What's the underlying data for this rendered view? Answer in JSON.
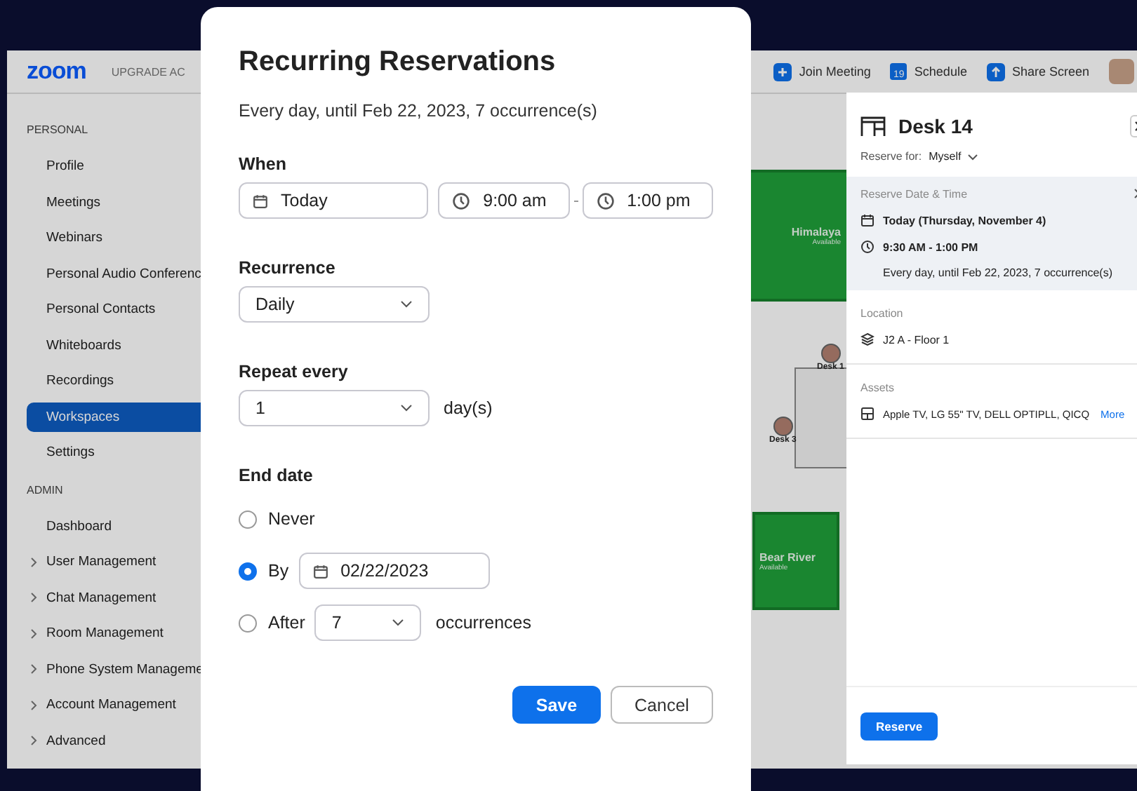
{
  "app": {
    "logo": "zoom",
    "upgrade": "UPGRADE AC",
    "header_actions": [
      {
        "kind": "plus",
        "label": "Join Meeting"
      },
      {
        "kind": "calendar",
        "label": "Schedule",
        "badge": "19"
      },
      {
        "kind": "share",
        "label": "Share Screen"
      }
    ],
    "sidebar": [
      {
        "heading": "PERSONAL",
        "items": [
          {
            "label": "Profile",
            "selected": false,
            "expandable": false
          },
          {
            "label": "Meetings",
            "selected": false,
            "expandable": false
          },
          {
            "label": "Webinars",
            "selected": false,
            "expandable": false
          },
          {
            "label": "Personal Audio Conferenc",
            "selected": false,
            "expandable": false
          },
          {
            "label": "Personal Contacts",
            "selected": false,
            "expandable": false
          },
          {
            "label": "Whiteboards",
            "selected": false,
            "expandable": false
          },
          {
            "label": "Recordings",
            "selected": false,
            "expandable": false
          },
          {
            "label": "Workspaces",
            "selected": true,
            "expandable": false
          },
          {
            "label": "Settings",
            "selected": false,
            "expandable": false
          }
        ]
      },
      {
        "heading": "ADMIN",
        "items": [
          {
            "label": "Dashboard",
            "selected": false,
            "expandable": false
          },
          {
            "label": "User Management",
            "selected": false,
            "expandable": true
          },
          {
            "label": "Chat Management",
            "selected": false,
            "expandable": true
          },
          {
            "label": "Room Management",
            "selected": false,
            "expandable": true
          },
          {
            "label": "Phone System Manageme",
            "selected": false,
            "expandable": true
          },
          {
            "label": "Account Management",
            "selected": false,
            "expandable": true
          },
          {
            "label": "Advanced",
            "selected": false,
            "expandable": true
          }
        ]
      }
    ],
    "map": {
      "rooms": [
        {
          "name": "Himalaya",
          "status": "Available"
        },
        {
          "name": "Bear River",
          "status": "Available"
        }
      ],
      "desks": [
        {
          "label": "Desk 1"
        },
        {
          "label": "Desk 3"
        }
      ]
    }
  },
  "drawer": {
    "title": "Desk 14",
    "reserve_for_label": "Reserve for:",
    "reserve_for": "Myself",
    "date_section": {
      "heading": "Reserve Date & Time",
      "date": "Today (Thursday, November 4)",
      "time": "9:30 AM - 1:00 PM",
      "recurrence": "Every day, until Feb 22, 2023, 7 occurrence(s)"
    },
    "location": {
      "heading": "Location",
      "value": "J2 A - Floor 1"
    },
    "assets": {
      "heading": "Assets",
      "value": "Apple TV, LG 55\" TV, DELL OPTIPLL, QICQ",
      "more": "More"
    },
    "button": "Reserve"
  },
  "dialog": {
    "title": "Recurring Reservations",
    "summary": "Every day, until Feb 22, 2023, 7 occurrence(s)",
    "when": {
      "label": "When",
      "date": "Today",
      "start": "9:00 am",
      "end": "1:00 pm"
    },
    "recurrence": {
      "label": "Recurrence",
      "value": "Daily"
    },
    "repeat_every": {
      "label": "Repeat every",
      "value": "1",
      "unit": "day(s)"
    },
    "end_date": {
      "label": "End date",
      "options": [
        {
          "kind": "never",
          "label": "Never",
          "selected": false
        },
        {
          "kind": "by",
          "label": "By",
          "value": "02/22/2023",
          "selected": true
        },
        {
          "kind": "after",
          "label": "After",
          "value": "7",
          "unit": "occurrences",
          "selected": false
        }
      ]
    },
    "buttons": [
      {
        "kind": "primary",
        "label": "Save"
      },
      {
        "kind": "secondary",
        "label": "Cancel"
      }
    ]
  }
}
